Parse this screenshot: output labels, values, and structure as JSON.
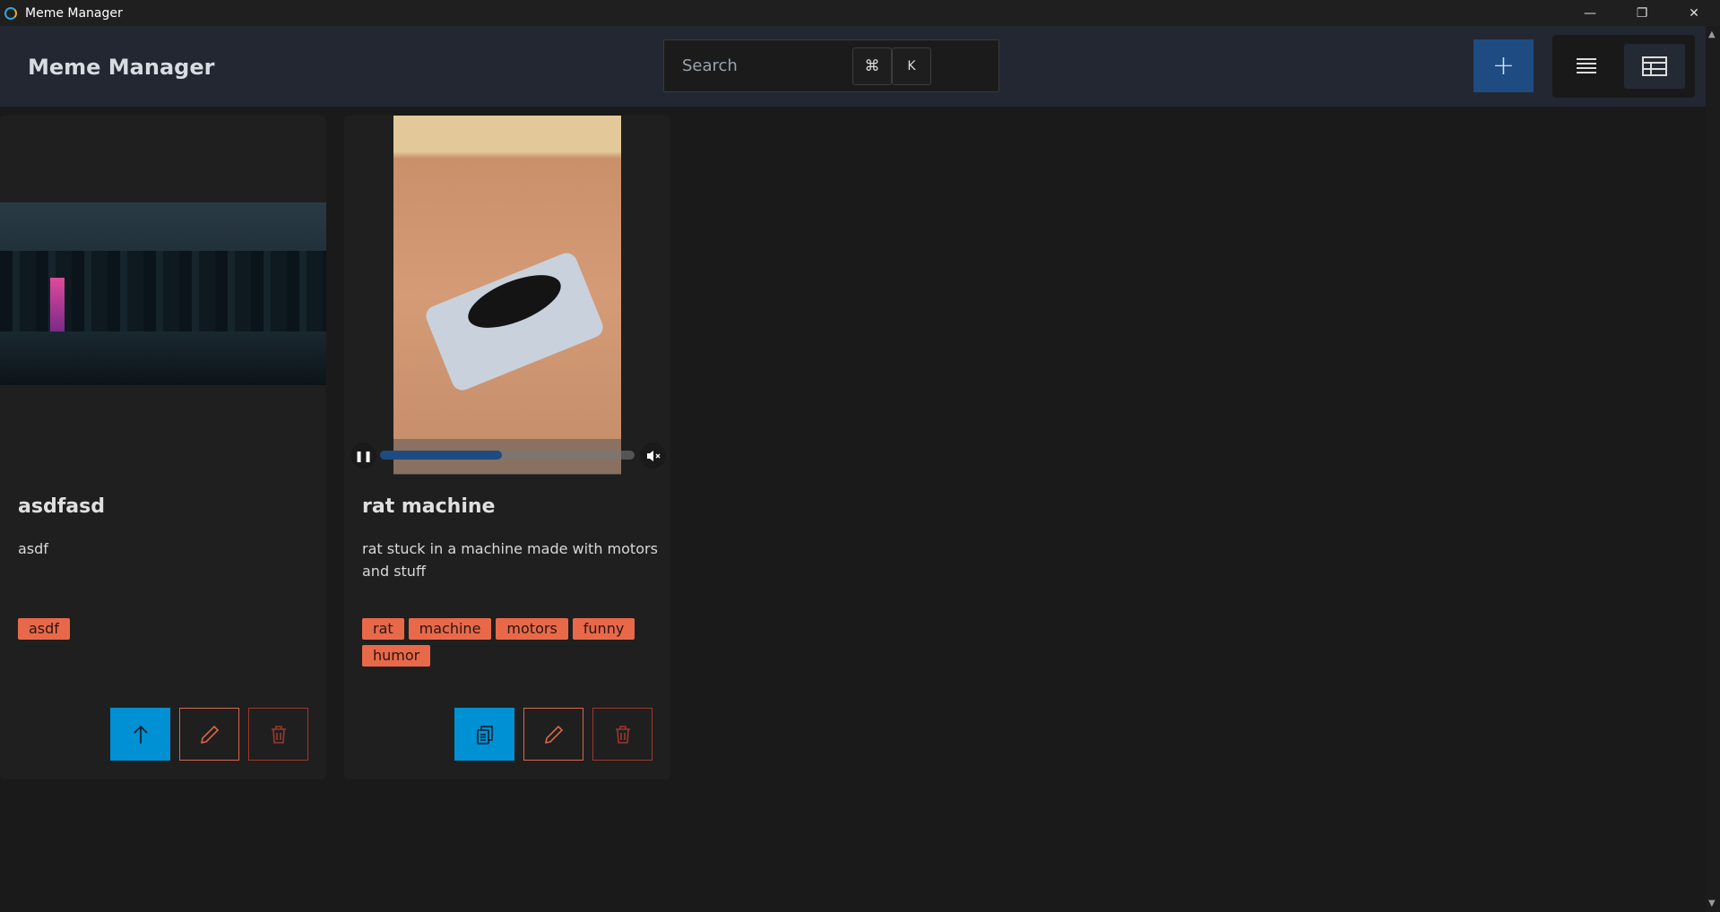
{
  "window": {
    "title": "Meme Manager",
    "controls": [
      "minimize",
      "restore",
      "close"
    ]
  },
  "header": {
    "brand": "Meme Manager",
    "search": {
      "placeholder": "Search",
      "shortcut_keys": [
        "⌘",
        "K"
      ]
    },
    "add_label": "+",
    "views": [
      {
        "name": "list",
        "active": false
      },
      {
        "name": "table",
        "active": true
      }
    ]
  },
  "colors": {
    "accent": "#1e4c82",
    "tag": "#e8694a",
    "primary_button": "#0090d4",
    "edit": "#d9664a",
    "delete": "#a0372b"
  },
  "cards": [
    {
      "title": "asdfasd",
      "description": "asdf",
      "tags": [
        "asdf"
      ],
      "media": "image",
      "primary_action": "upload-icon"
    },
    {
      "title": "rat machine",
      "description": "rat stuck in a machine made with motors and stuff",
      "tags": [
        "rat",
        "machine",
        "motors",
        "funny",
        "humor"
      ],
      "media": "video",
      "video": {
        "playing": true,
        "muted": true,
        "progress_percent": 48
      },
      "primary_action": "copy-icon"
    }
  ]
}
